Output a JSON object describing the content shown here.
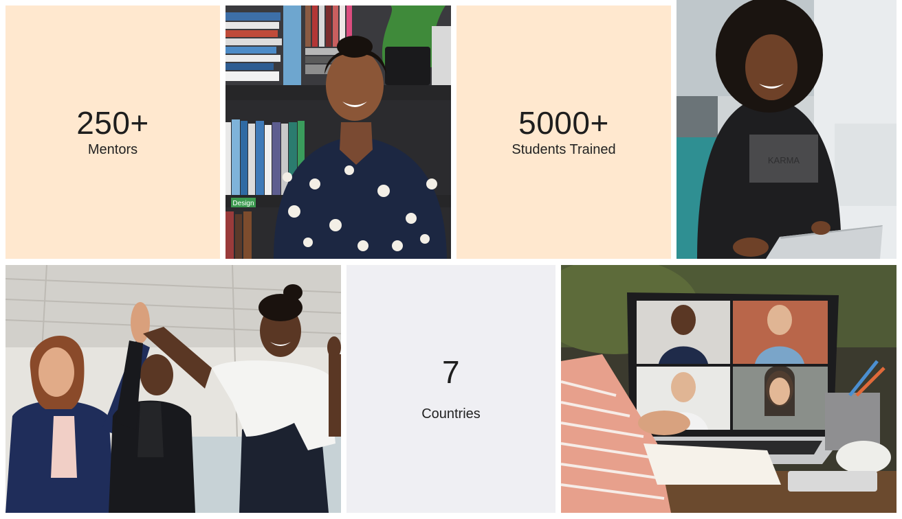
{
  "stats": [
    {
      "number": "250+",
      "label": "Mentors"
    },
    {
      "number": "5000+",
      "label": "Students Trained"
    },
    {
      "number": "7",
      "label": "Countries"
    }
  ],
  "photos": [
    {
      "icon": "mentor-portrait-photo",
      "book_label": "Design",
      "shirt_text": ""
    },
    {
      "icon": "woman-with-laptop-photo",
      "book_label": "",
      "shirt_text": "KARMA"
    },
    {
      "icon": "team-high-five-photo",
      "book_label": "",
      "shirt_text": ""
    },
    {
      "icon": "video-call-laptop-photo",
      "book_label": "",
      "shirt_text": ""
    }
  ],
  "colors": {
    "peach_tile": "#ffe8cf",
    "gray_tile": "#efeff3",
    "text": "#1e1e1e"
  }
}
